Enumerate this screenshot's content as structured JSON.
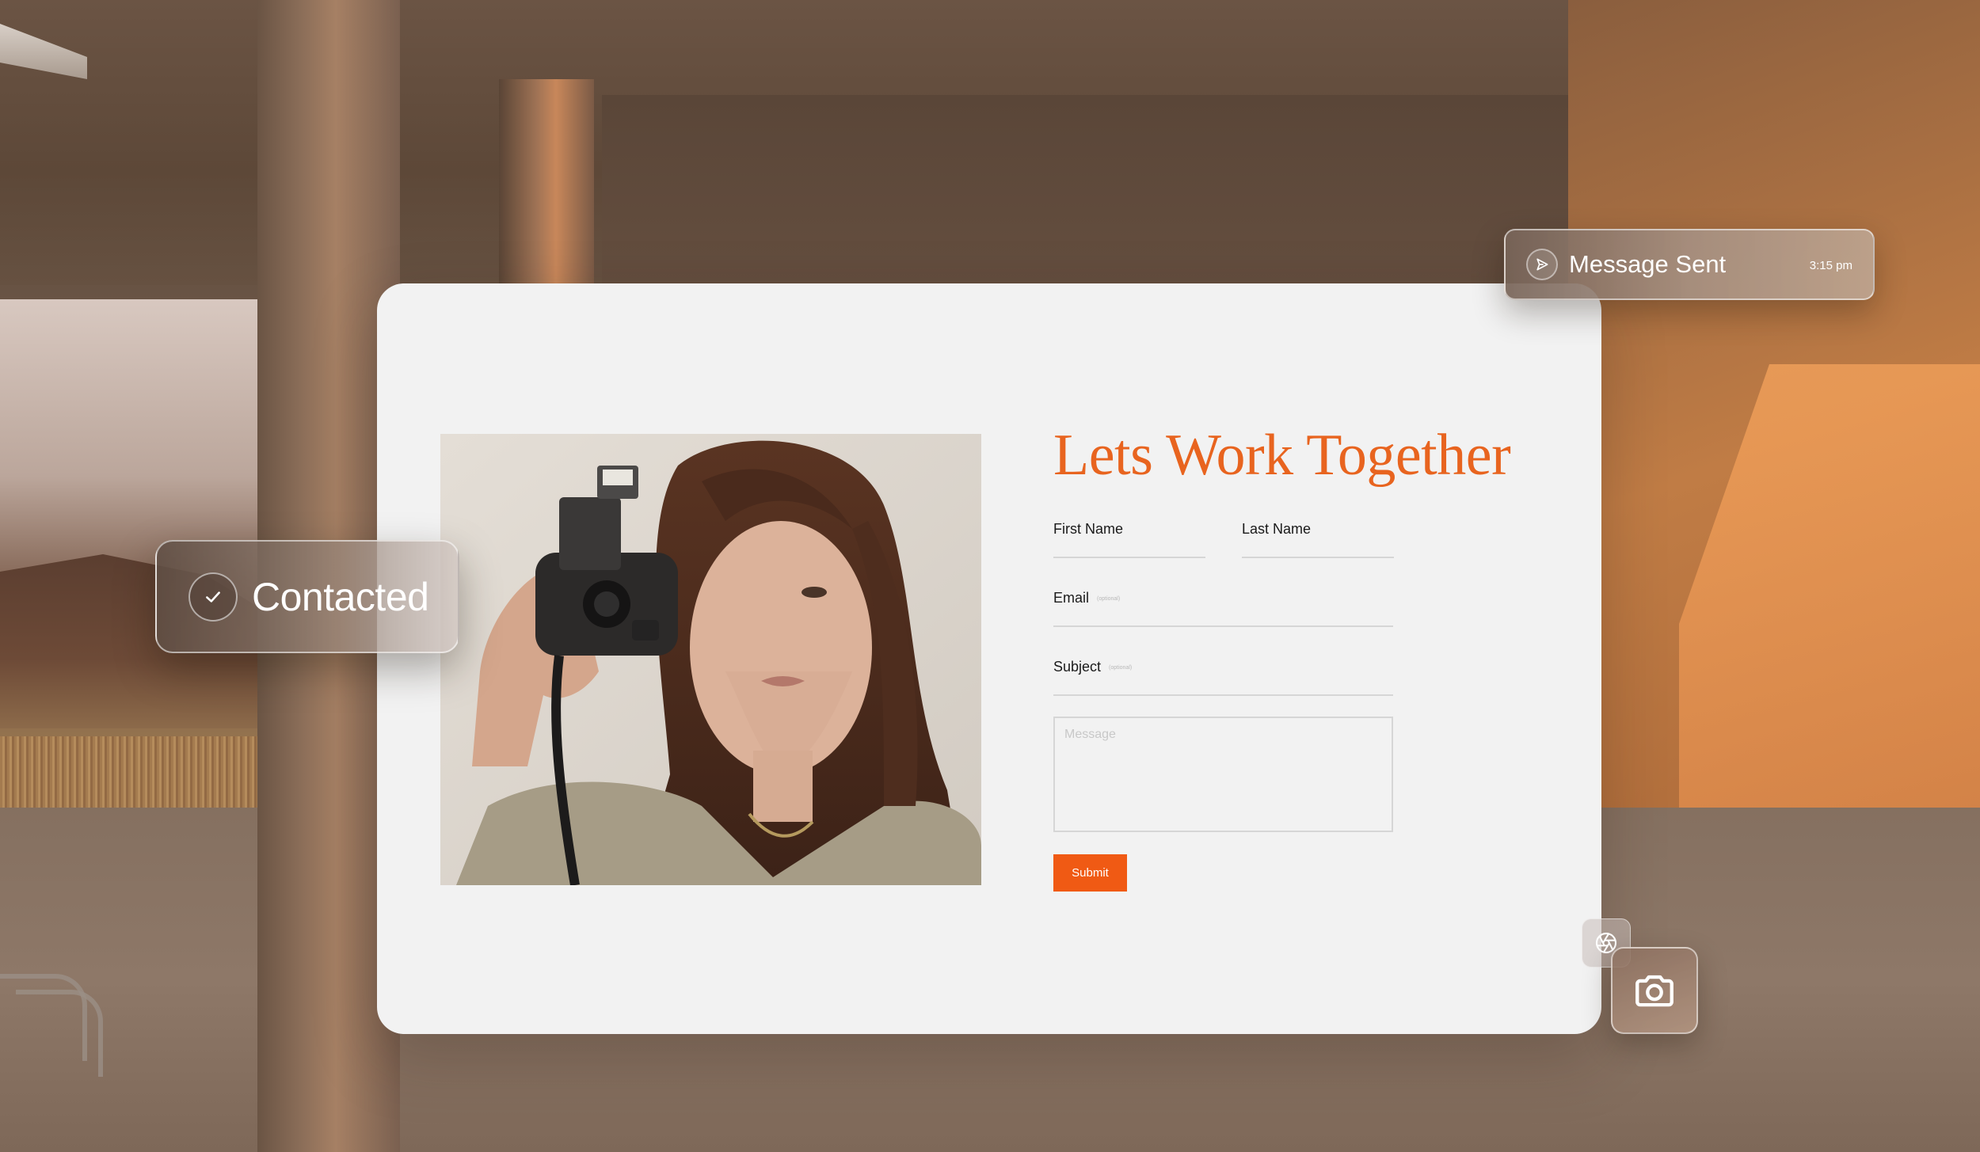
{
  "form": {
    "headline": "Lets Work Together",
    "first_name_label": "First Name",
    "last_name_label": "Last Name",
    "email_label": "Email",
    "email_optional": "(optional)",
    "subject_label": "Subject",
    "subject_optional": "(optional)",
    "message_placeholder": "Message",
    "submit_label": "Submit"
  },
  "chips": {
    "contacted_label": "Contacted",
    "sent_label": "Message Sent",
    "sent_time": "3:15 pm"
  },
  "icons": {
    "contacted": "check-icon",
    "sent": "send-icon",
    "aperture": "aperture-icon",
    "camera": "camera-icon"
  },
  "colors": {
    "accent": "#f05a14",
    "headline": "#e8641f",
    "card_bg": "#f2f2f2"
  }
}
